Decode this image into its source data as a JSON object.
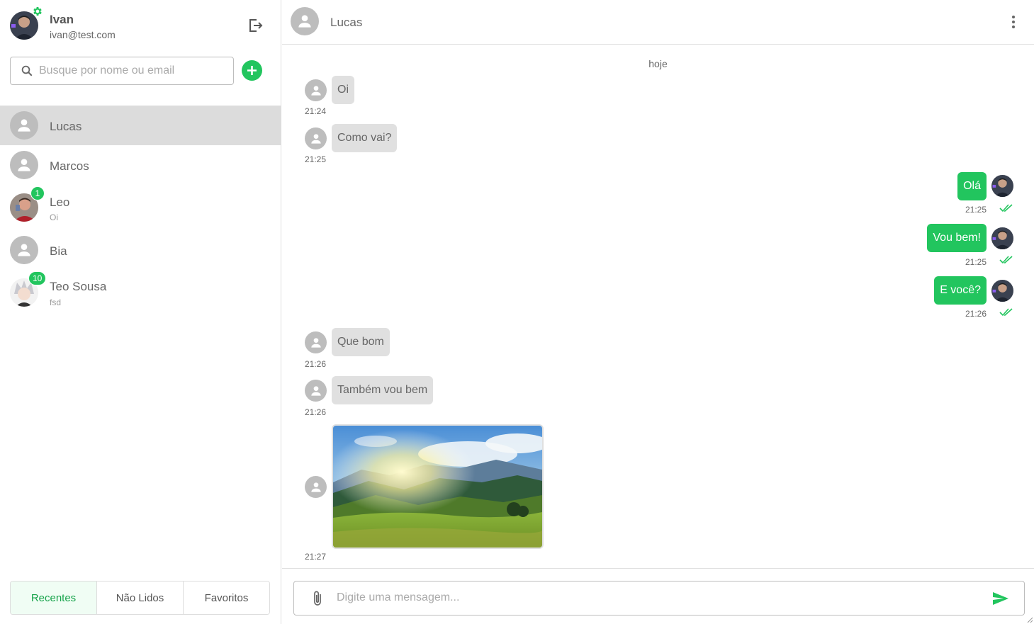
{
  "user": {
    "name": "Ivan",
    "email": "ivan@test.com"
  },
  "search": {
    "placeholder": "Busque por nome ou email"
  },
  "contacts": [
    {
      "name": "Lucas",
      "preview": "",
      "badge": ""
    },
    {
      "name": "Marcos",
      "preview": "",
      "badge": ""
    },
    {
      "name": "Leo",
      "preview": "Oi",
      "badge": "1"
    },
    {
      "name": "Bia",
      "preview": "",
      "badge": ""
    },
    {
      "name": "Teo Sousa",
      "preview": "fsd",
      "badge": "10"
    }
  ],
  "tabs": [
    {
      "label": "Recentes",
      "active": true
    },
    {
      "label": "Não Lidos",
      "active": false
    },
    {
      "label": "Favoritos",
      "active": false
    }
  ],
  "chat": {
    "contact_name": "Lucas",
    "date_separator": "hoje",
    "messages": [
      {
        "direction": "in",
        "text": "Oi",
        "time": "21:24"
      },
      {
        "direction": "in",
        "text": "Como vai?",
        "time": "21:25"
      },
      {
        "direction": "out",
        "text": "Olá",
        "time": "21:25"
      },
      {
        "direction": "out",
        "text": "Vou bem!",
        "time": "21:25"
      },
      {
        "direction": "out",
        "text": "E você?",
        "time": "21:26"
      },
      {
        "direction": "in",
        "text": "Que bom",
        "time": "21:26"
      },
      {
        "direction": "in",
        "text": "Também vou bem",
        "time": "21:26"
      },
      {
        "direction": "in",
        "type": "image",
        "time": "21:27"
      }
    ]
  },
  "composer": {
    "placeholder": "Digite uma mensagem..."
  },
  "colors": {
    "accent": "#22c55e",
    "incoming_bubble": "#e0e0e0",
    "active_contact": "#dcdcdc"
  }
}
